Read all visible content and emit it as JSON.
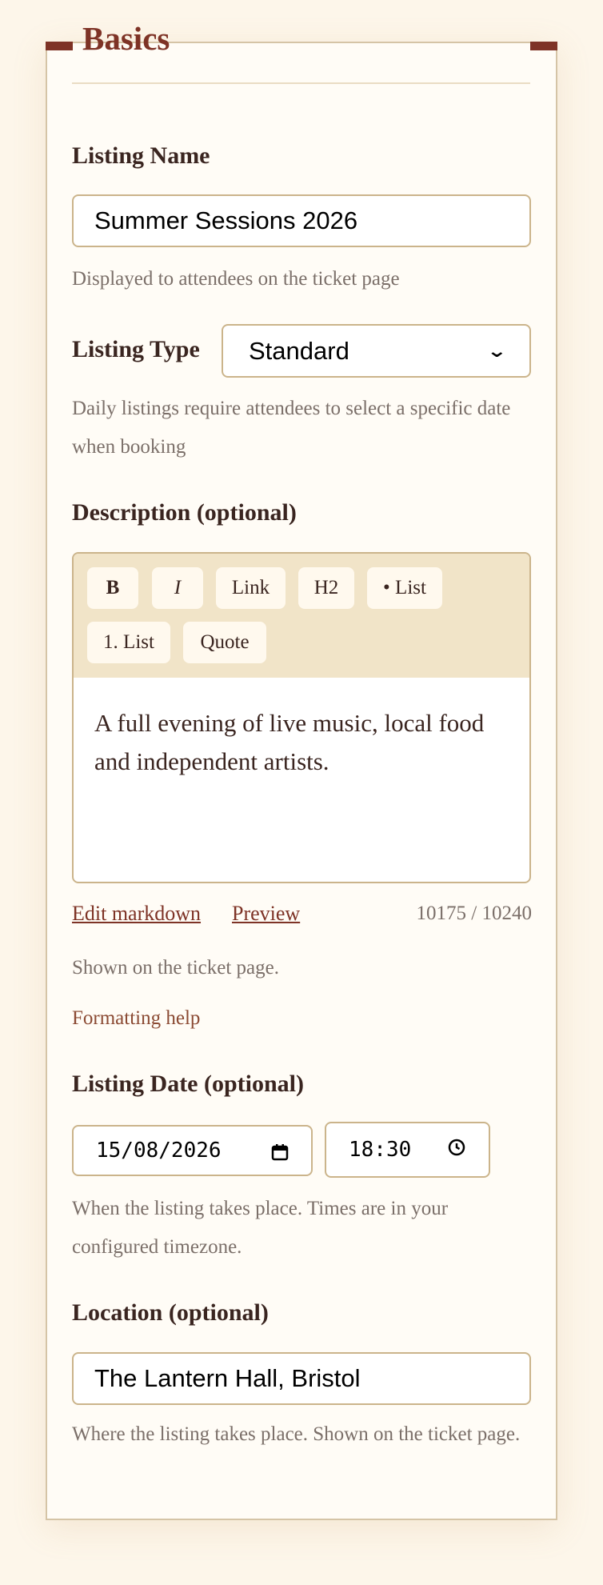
{
  "fieldset": {
    "legend": "Basics"
  },
  "listing_name": {
    "label": "Listing Name",
    "value": "Summer Sessions 2026",
    "hint": "Displayed to attendees on the ticket page"
  },
  "listing_type": {
    "label": "Listing Type",
    "selected": "Standard",
    "hint": "Daily listings require attendees to select a specific date when booking"
  },
  "description": {
    "label": "Description (optional)",
    "toolbar": [
      "B",
      "I",
      "Link",
      "H2",
      "• List",
      "1. List",
      "Quote"
    ],
    "content": "A full evening of live music, local food and independent artists.",
    "edit_markdown": "Edit markdown",
    "preview": "Preview",
    "char_count": "10175 / 10240",
    "hint": "Shown on the ticket page.",
    "formatting_help": "Formatting help"
  },
  "listing_date": {
    "label": "Listing Date (optional)",
    "date": "15/08/2026",
    "time": "18:30",
    "hint": "When the listing takes place. Times are in your configured timezone."
  },
  "location": {
    "label": "Location (optional)",
    "value": "The Lantern Hall, Bristol",
    "hint": "Where the listing takes place. Shown on the ticket page."
  },
  "icons": {
    "select_arrow": "chevron-down-icon",
    "date_picker": "calendar-icon",
    "time_picker": "clock-icon"
  },
  "colors": {
    "accent": "#7e3326",
    "page_bg": "#fdf6ea",
    "card_bg": "#fffcf6",
    "border": "#cbb48b",
    "toolbar_bg": "#f1e4c8"
  }
}
